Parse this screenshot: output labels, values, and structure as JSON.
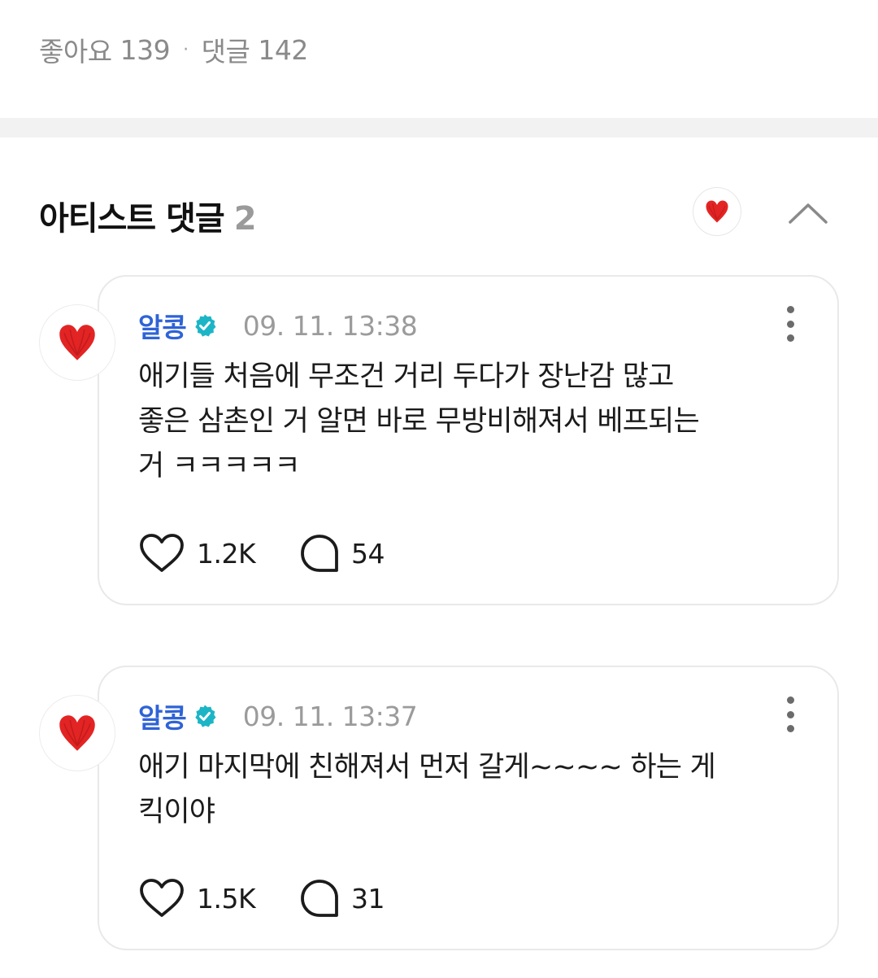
{
  "stats": {
    "likes_label": "좋아요",
    "likes_count": "139",
    "separator": "·",
    "comments_label": "댓글",
    "comments_count": "142"
  },
  "section": {
    "title": "아티스트 댓글",
    "count": "2"
  },
  "colors": {
    "author": "#2f63d6",
    "verified_badge": "#1cb5c6",
    "heart_avatar": "#e32424",
    "divider_band": "#f2f2f2"
  },
  "icons": {
    "section_avatar": "red-heart-icon",
    "collapse": "chevron-up-icon",
    "badge": "verified-badge-icon",
    "more": "more-vertical-icon",
    "like": "heart-outline-icon",
    "reply": "speech-bubble-icon"
  },
  "comments": [
    {
      "author": "알콩",
      "timestamp": "09. 11. 13:38",
      "text": "애기들 처음에 무조건 거리 두다가 장난감 많고\n좋은 삼촌인 거 알면 바로 무방비해져서 베프되는\n거 ㅋㅋㅋㅋㅋ",
      "likes": "1.2K",
      "replies": "54"
    },
    {
      "author": "알콩",
      "timestamp": "09. 11. 13:37",
      "text": "애기 마지막에 친해져서 먼저 갈게~~~~ 하는 게\n킥이야",
      "likes": "1.5K",
      "replies": "31"
    }
  ]
}
